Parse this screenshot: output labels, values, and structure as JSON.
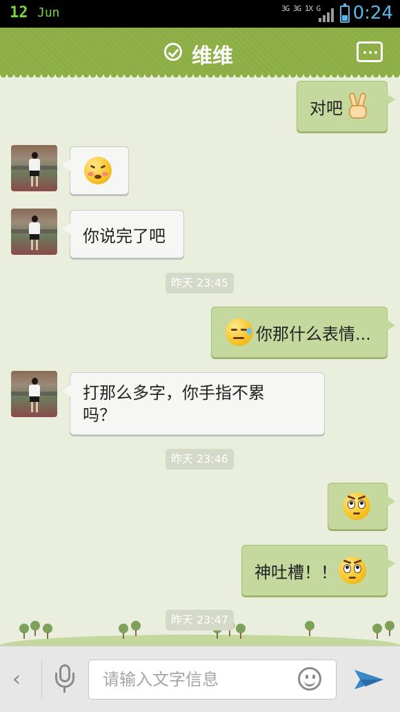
{
  "status_bar": {
    "date_day": "12",
    "date_month": "Jun",
    "network": "3G 3G 1X G",
    "time": "0:24"
  },
  "header": {
    "title": "维维"
  },
  "messages": [
    {
      "side": "right",
      "text": "对吧",
      "emoji": "victory-hand"
    },
    {
      "side": "left",
      "text": "",
      "emoji": "hehe-face"
    },
    {
      "side": "left",
      "text": "你说完了吧"
    },
    {
      "timestamp": "昨天 23:45"
    },
    {
      "side": "right",
      "text": "你那什么表情...",
      "emoji": "sweat-face"
    },
    {
      "side": "left",
      "text_line1": "打那么多字，你手指不累",
      "text_line2": "吗？"
    },
    {
      "timestamp": "昨天 23:46"
    },
    {
      "side": "right",
      "text": "",
      "emoji": "eye-roll-face"
    },
    {
      "side": "right",
      "text": "神吐槽！！",
      "emoji": "eye-roll-face"
    },
    {
      "timestamp": "昨天 23:47"
    }
  ],
  "input": {
    "placeholder": "请输入文字信息"
  },
  "icons": {
    "back": "chevron-left-icon",
    "mic": "microphone-icon",
    "emoji": "smiley-icon",
    "send": "send-arrow-icon",
    "more": "more-icon",
    "verified": "check-circle-icon"
  },
  "colors": {
    "header": "#8cae45",
    "chat_bg": "#e9eedd",
    "bubble_sent": "#c5d89e",
    "bubble_received": "#f6f6f4",
    "accent_blue": "#3a87c8"
  }
}
